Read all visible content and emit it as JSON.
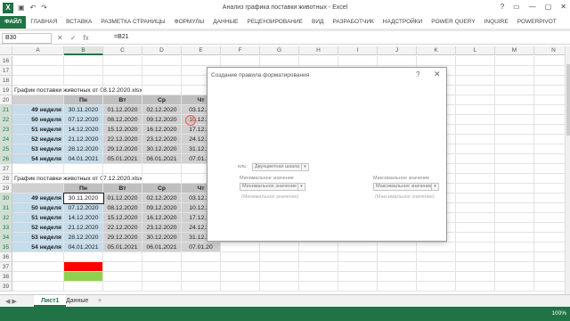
{
  "window": {
    "app_icon": "X",
    "title": "Анализ графика поставки животных - Excel",
    "controls": [
      "?",
      "▭",
      "—",
      "▢",
      "✕"
    ]
  },
  "qat": {
    "save_icon": "save-icon",
    "undo_icon": "undo-icon",
    "redo_icon": "redo-icon"
  },
  "ribbon": {
    "tabs": [
      "ФАЙЛ",
      "ГЛАВНАЯ",
      "ВСТАВКА",
      "РАЗМЕТКА СТРАНИЦЫ",
      "ФОРМУЛЫ",
      "ДАННЫЕ",
      "РЕЦЕНЗИРОВАНИЕ",
      "ВИД",
      "РАЗРАБОТЧИК",
      "НАДСТРОЙКИ",
      "POWER QUERY",
      "INQUIRE",
      "POWERPIVOT"
    ]
  },
  "formula_bar": {
    "name_box": "B30",
    "cancel": "✕",
    "enter": "✓",
    "fx": "fx",
    "formula": "=B21"
  },
  "columns": [
    "A",
    "B",
    "C",
    "D",
    "E",
    "F",
    "G",
    "H",
    "I",
    "J",
    "K",
    "L",
    "M",
    "N"
  ],
  "rows": [
    {
      "n": "16",
      "cells": {}
    },
    {
      "n": "17",
      "cells": {}
    },
    {
      "n": "18",
      "cells": {}
    },
    {
      "n": "19",
      "cells": {
        "A": "График поставки животных от 08.12.2020.xlsx"
      }
    },
    {
      "n": "20",
      "cells": {
        "B": "Пн",
        "C": "Вт",
        "D": "Ср",
        "E": "Чт"
      }
    },
    {
      "n": "21",
      "cells": {
        "A": "49 неделя",
        "B": "30.11.2020",
        "C": "01.12.2020",
        "D": "02.12.2020",
        "E": "03.12.20"
      }
    },
    {
      "n": "22",
      "cells": {
        "A": "50 неделя",
        "B": "07.12.2020",
        "C": "08.12.2020",
        "D": "09.12.2020",
        "E": "10.12.20"
      }
    },
    {
      "n": "23",
      "cells": {
        "A": "51 неделя",
        "B": "14.12.2020",
        "C": "15.12.2020",
        "D": "16.12.2020",
        "E": "17.12.20"
      }
    },
    {
      "n": "24",
      "cells": {
        "A": "52 неделя",
        "B": "21.12.2020",
        "C": "22.12.2020",
        "D": "23.12.2020",
        "E": "24.12.20"
      }
    },
    {
      "n": "25",
      "cells": {
        "A": "53 неделя",
        "B": "28.12.2020",
        "C": "29.12.2020",
        "D": "30.12.2020",
        "E": "31.12.20"
      }
    },
    {
      "n": "26",
      "cells": {
        "A": "54 неделя",
        "B": "04.01.2021",
        "C": "05.01.2021",
        "D": "06.01.2021",
        "E": "07.01.20"
      }
    },
    {
      "n": "27",
      "cells": {}
    },
    {
      "n": "28",
      "cells": {
        "A": "График поставки животных от 07.12.2020.xlsx"
      }
    },
    {
      "n": "29",
      "cells": {
        "B": "Пн",
        "C": "Вт",
        "D": "Ср",
        "E": "Чт"
      }
    },
    {
      "n": "30",
      "cells": {
        "A": "49 неделя",
        "B": "30.11.2020",
        "C": "01.12.2020",
        "D": "02.12.2020",
        "E": "03.12.20"
      }
    },
    {
      "n": "31",
      "cells": {
        "A": "50 неделя",
        "B": "07.12.2020",
        "C": "08.12.2020",
        "D": "09.12.2020",
        "E": "10.12.20"
      }
    },
    {
      "n": "32",
      "cells": {
        "A": "51 неделя",
        "B": "14.12.2020",
        "C": "15.12.2020",
        "D": "16.12.2020",
        "E": "17.12.20"
      }
    },
    {
      "n": "33",
      "cells": {
        "A": "52 неделя",
        "B": "21.12.2020",
        "C": "22.12.2020",
        "D": "23.12.2020",
        "E": "24.12.20"
      }
    },
    {
      "n": "34",
      "cells": {
        "A": "53 неделя",
        "B": "28.12.2020",
        "C": "29.12.2020",
        "D": "30.12.2020",
        "E": "31.12.20"
      }
    },
    {
      "n": "35",
      "cells": {
        "A": "54 неделя",
        "B": "04.01.2021",
        "C": "05.01.2021",
        "D": "06.01.2021",
        "E": "07.01.20"
      }
    },
    {
      "n": "36",
      "cells": {}
    },
    {
      "n": "37",
      "cells": {}
    },
    {
      "n": "38",
      "cells": {}
    },
    {
      "n": "39",
      "cells": {}
    }
  ],
  "fills": {
    "red": "#ff0000",
    "green": "#92d050",
    "accent": "#217346"
  },
  "dialog": {
    "title": "Создание правила форматирования",
    "help": "?",
    "close": "✕",
    "style_label": "иль:",
    "style_value": "Двухцветная шкала",
    "min_label": "Минимальное значение",
    "min_type": "Минимальное значение",
    "min_value": "(Минимальное значение)",
    "max_label": "Максимальное значение",
    "max_type": "Максимальное значение",
    "max_value": "(Максимальное значение)"
  },
  "sheets": {
    "nav": "◀ ▶",
    "tabs": [
      "Лист1",
      "Данные"
    ],
    "add": "+"
  },
  "status": {
    "zoom": "100%"
  }
}
